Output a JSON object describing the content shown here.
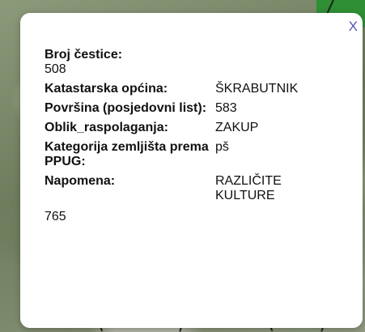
{
  "popup": {
    "close_label": "X",
    "title": "Broj čestice:",
    "parcel_number": "508",
    "rows": [
      {
        "key": "Katastarska općina:",
        "value": "ŠKRABUTNIK"
      },
      {
        "key": "Površina (posjedovni list):",
        "value": "583"
      },
      {
        "key": "Oblik_raspolaganja:",
        "value": "ZAKUP"
      },
      {
        "key": "Kategorija zemljišta prema PPUG:",
        "value": "pš"
      },
      {
        "key": "Napomena:",
        "value": "RAZLIČITE KULTURE"
      }
    ],
    "footer_value": "765"
  }
}
